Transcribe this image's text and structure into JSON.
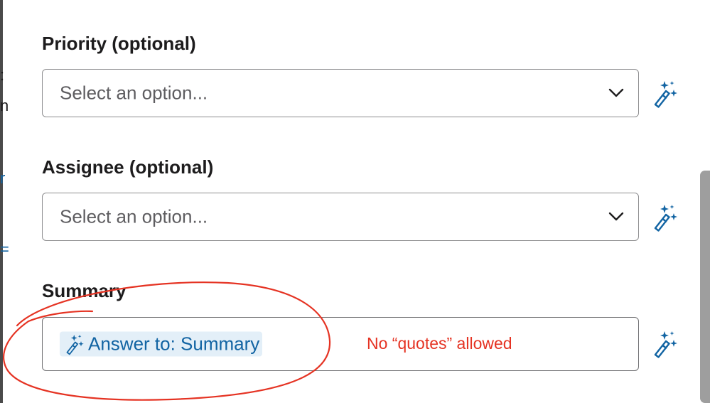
{
  "form": {
    "priority": {
      "label": "Priority (optional)",
      "placeholder": "Select an option..."
    },
    "assignee": {
      "label": "Assignee (optional)",
      "placeholder": "Select an option..."
    },
    "summary": {
      "label": "Summary",
      "token_text": "Answer to: Summary"
    }
  },
  "annotation": {
    "text": "No “quotes” allowed",
    "color": "#e53323"
  },
  "icons": {
    "field_action": "magic-wand-icon",
    "dropdown": "chevron-down-icon"
  },
  "colors": {
    "accent": "#1264a3",
    "token_bg": "#e3eff8"
  }
}
